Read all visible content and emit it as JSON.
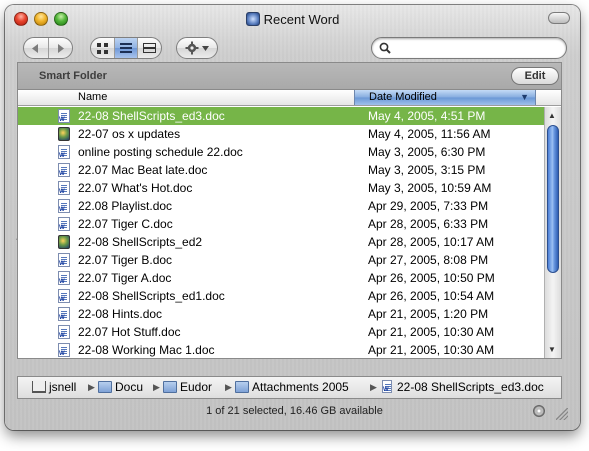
{
  "window": {
    "title": "Recent Word"
  },
  "toolbar": {
    "back_icon": "back-arrow-icon",
    "forward_icon": "forward-arrow-icon",
    "view_modes": [
      "icon-view",
      "list-view",
      "column-view"
    ],
    "active_view": "list-view",
    "action_menu_icon": "gear-icon",
    "search": {
      "value": "",
      "placeholder": ""
    }
  },
  "smart_folder": {
    "label": "Smart Folder",
    "edit_label": "Edit"
  },
  "columns": {
    "name": "Name",
    "date_modified": "Date Modified",
    "sort_indicator": "▼"
  },
  "files": [
    {
      "name": "22-08 ShellScripts_ed3.doc",
      "date": "May 4, 2005, 4:51 PM",
      "icon": "word-document-icon",
      "selected": true
    },
    {
      "name": "22-07 os x updates",
      "date": "May 4, 2005, 11:56 AM",
      "icon": "application-icon",
      "selected": false
    },
    {
      "name": "online posting schedule 22.doc",
      "date": "May 3, 2005, 6:30 PM",
      "icon": "word-document-icon",
      "selected": false
    },
    {
      "name": "22.07 Mac Beat late.doc",
      "date": "May 3, 2005, 3:15 PM",
      "icon": "word-document-icon",
      "selected": false
    },
    {
      "name": "22.07 What's Hot.doc",
      "date": "May 3, 2005, 10:59 AM",
      "icon": "word-document-icon",
      "selected": false
    },
    {
      "name": "22.08 Playlist.doc",
      "date": "Apr 29, 2005, 7:33 PM",
      "icon": "word-document-icon",
      "selected": false
    },
    {
      "name": "22.07 Tiger C.doc",
      "date": "Apr 28, 2005, 6:33 PM",
      "icon": "word-document-icon",
      "selected": false
    },
    {
      "name": "22-08 ShellScripts_ed2",
      "date": "Apr 28, 2005, 10:17 AM",
      "icon": "application-icon",
      "selected": false
    },
    {
      "name": "22.07 Tiger B.doc",
      "date": "Apr 27, 2005, 8:08 PM",
      "icon": "word-document-icon",
      "selected": false
    },
    {
      "name": "22.07 Tiger A.doc",
      "date": "Apr 26, 2005, 10:50 PM",
      "icon": "word-document-icon",
      "selected": false
    },
    {
      "name": "22-08 ShellScripts_ed1.doc",
      "date": "Apr 26, 2005, 10:54 AM",
      "icon": "word-document-icon",
      "selected": false
    },
    {
      "name": "22-08 Hints.doc",
      "date": "Apr 21, 2005, 1:20 PM",
      "icon": "word-document-icon",
      "selected": false
    },
    {
      "name": "22.07 Hot Stuff.doc",
      "date": "Apr 21, 2005, 10:30 AM",
      "icon": "word-document-icon",
      "selected": false
    },
    {
      "name": "22-08 Working Mac 1.doc",
      "date": "Apr 21, 2005, 10:30 AM",
      "icon": "word-document-icon",
      "selected": false
    }
  ],
  "path": [
    {
      "label": "jsnell",
      "icon": "home-icon"
    },
    {
      "label": "Docu",
      "icon": "folder-icon"
    },
    {
      "label": "Eudor",
      "icon": "folder-icon"
    },
    {
      "label": "Attachments 2005",
      "icon": "folder-icon"
    },
    {
      "label": "22-08 ShellScripts_ed3.doc",
      "icon": "word-document-icon"
    }
  ],
  "status": {
    "text": "1 of 21 selected, 16.46 GB available"
  },
  "colors": {
    "selection": "#76b548",
    "sort_column": "#85acdf",
    "scroll_thumb": "#6b9ae2"
  }
}
